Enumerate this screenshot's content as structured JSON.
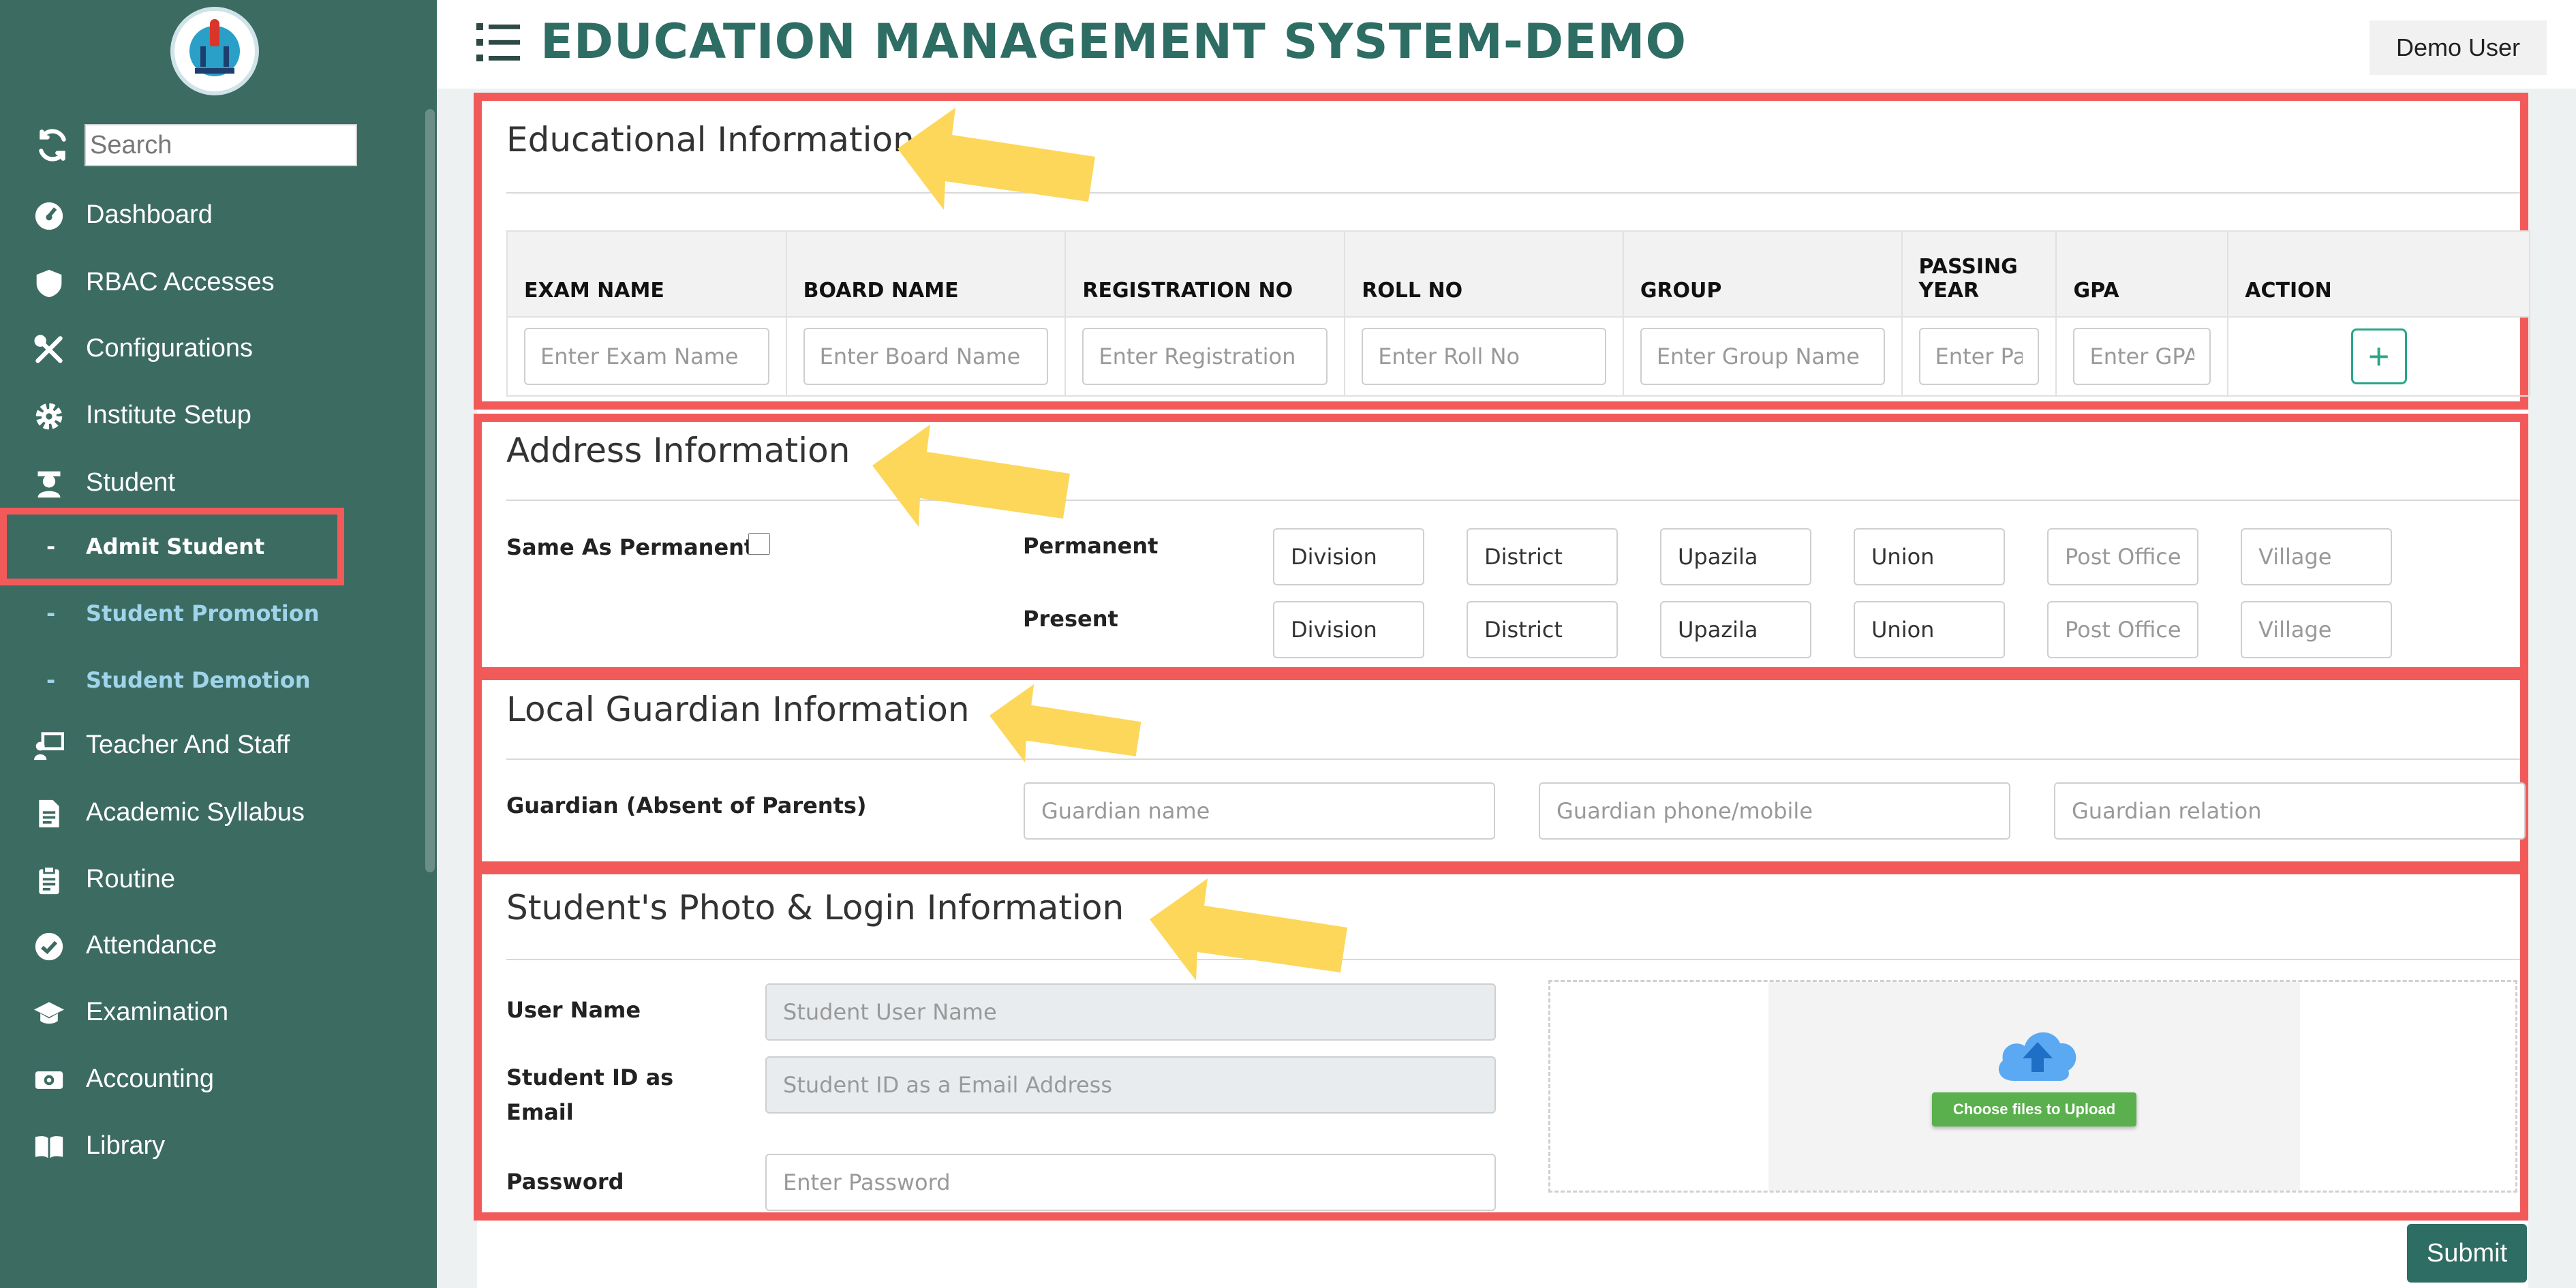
{
  "app": {
    "title": "EDUCATION MANAGEMENT SYSTEM-DEMO",
    "user": "Demo User"
  },
  "search": {
    "placeholder": "Search"
  },
  "sidebar": {
    "items": [
      {
        "label": "Dashboard",
        "icon": "dashboard-icon"
      },
      {
        "label": "RBAC Accesses",
        "icon": "shield-icon"
      },
      {
        "label": "Configurations",
        "icon": "tools-icon"
      },
      {
        "label": "Institute Setup",
        "icon": "gear-icon"
      },
      {
        "label": "Student",
        "icon": "student-icon"
      },
      {
        "label": "Teacher And Staff",
        "icon": "teacher-icon"
      },
      {
        "label": "Academic Syllabus",
        "icon": "document-icon"
      },
      {
        "label": "Routine",
        "icon": "clipboard-icon"
      },
      {
        "label": "Attendance",
        "icon": "check-circle-icon"
      },
      {
        "label": "Examination",
        "icon": "graduation-cap-icon"
      },
      {
        "label": "Accounting",
        "icon": "money-icon"
      },
      {
        "label": "Library",
        "icon": "book-icon"
      }
    ],
    "student_sub": [
      {
        "label": "Admit Student",
        "active": true
      },
      {
        "label": "Student Promotion",
        "active": false
      },
      {
        "label": "Student Demotion",
        "active": false
      }
    ],
    "sub_dash": "-"
  },
  "education": {
    "title": "Educational Information",
    "columns": [
      "EXAM NAME",
      "BOARD NAME",
      "REGISTRATION NO",
      "ROLL NO",
      "GROUP",
      "PASSING YEAR",
      "GPA",
      "ACTION"
    ],
    "placeholders": [
      "Enter Exam Name",
      "Enter Board Name",
      "Enter Registration",
      "Enter Roll No",
      "Enter Group Name",
      "Enter Pas",
      "Enter GPA"
    ],
    "add_label": "+"
  },
  "address": {
    "title": "Address Information",
    "same_label": "Same As Permanent",
    "permanent_label": "Permanent",
    "present_label": "Present",
    "fields": [
      "Division",
      "District",
      "Upazila",
      "Union",
      "Post Office",
      "Village"
    ]
  },
  "guardian": {
    "title": "Local Guardian Information",
    "label": "Guardian (Absent of Parents)",
    "name_placeholder": "Guardian name",
    "phone_placeholder": "Guardian phone/mobile",
    "relation_placeholder": "Guardian relation"
  },
  "login": {
    "title": "Student's Photo & Login Information",
    "username_label": "User Name",
    "username_placeholder": "Student User Name",
    "email_label_line1": "Student ID as",
    "email_label_line2": "Email",
    "email_placeholder": "Student ID as a Email Address",
    "password_label": "Password",
    "password_placeholder": "Enter Password",
    "upload_label": "Choose files to Upload"
  },
  "submit_label": "Submit",
  "colors": {
    "sidebar": "#3c6b62",
    "accent": "#2e6d63",
    "highlight": "#f25a5a",
    "arrow": "#fcd75a",
    "upload": "#5ab04c"
  }
}
